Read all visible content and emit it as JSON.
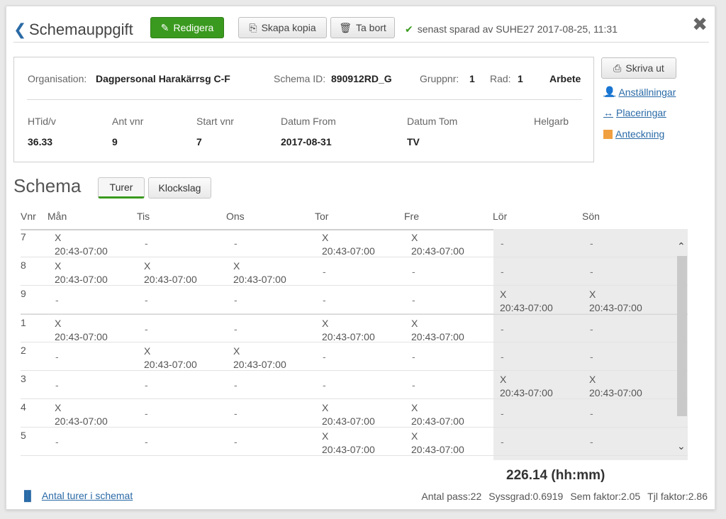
{
  "header": {
    "title": "Schemauppgift",
    "edit_label": "Redigera",
    "copy_label": "Skapa kopia",
    "delete_label": "Ta bort",
    "saved_text": "senast sparad av SUHE27 2017-08-25, 11:31"
  },
  "info": {
    "org_label": "Organisation:",
    "org_value": "Dagpersonal Harakärrsg C-F",
    "schema_id_label": "Schema ID:",
    "schema_id_value": "890912RD_G",
    "gruppnr_label": "Gruppnr:",
    "gruppnr_value": "1",
    "rad_label": "Rad:",
    "rad_value": "1",
    "arbete": "Arbete",
    "htid_label": "HTid/v",
    "htid_value": "36.33",
    "antvnr_label": "Ant vnr",
    "antvnr_value": "9",
    "startvnr_label": "Start vnr",
    "startvnr_value": "7",
    "datumfrom_label": "Datum From",
    "datumfrom_value": "2017-08-31",
    "datumtom_label": "Datum Tom",
    "datumtom_value": "TV",
    "helgarb_label": "Helgarb"
  },
  "side": {
    "print_label": "Skriva ut",
    "settings_label": "Anställningar",
    "placements_label": "Placeringar",
    "note_label": "Anteckning"
  },
  "schema": {
    "title": "Schema",
    "tab_turer": "Turer",
    "tab_klockslag": "Klockslag",
    "columns": [
      "Vnr",
      "Mån",
      "Tis",
      "Ons",
      "Tor",
      "Fre",
      "Lör",
      "Sön"
    ],
    "shift_mark": "X",
    "shift_time": "20:43-07:00",
    "empty": "-",
    "rows": [
      {
        "vnr": "7",
        "days": [
          1,
          0,
          0,
          1,
          1,
          0,
          0
        ]
      },
      {
        "vnr": "8",
        "days": [
          1,
          1,
          1,
          0,
          0,
          0,
          0
        ]
      },
      {
        "vnr": "9",
        "days": [
          0,
          0,
          0,
          0,
          0,
          1,
          1
        ]
      },
      {
        "vnr": "1",
        "days": [
          1,
          0,
          0,
          1,
          1,
          0,
          0
        ]
      },
      {
        "vnr": "2",
        "days": [
          0,
          1,
          1,
          0,
          0,
          0,
          0
        ]
      },
      {
        "vnr": "3",
        "days": [
          0,
          0,
          0,
          0,
          0,
          1,
          1
        ]
      },
      {
        "vnr": "4",
        "days": [
          1,
          0,
          0,
          1,
          1,
          0,
          0
        ]
      },
      {
        "vnr": "5",
        "days": [
          0,
          0,
          0,
          1,
          1,
          0,
          0
        ]
      }
    ]
  },
  "footer": {
    "total": "226.14 (hh:mm)",
    "link_label": "Antal turer i schemat",
    "antal_pass": "Antal pass:22",
    "syssgrad": "Syssgrad:0.6919",
    "sem_faktor": "Sem faktor:2.05",
    "tjl_faktor": "Tjl faktor:2.86"
  },
  "colors": {
    "accent_green": "#3a9a1f",
    "link_blue": "#2a6aa6",
    "weekend_bg": "#ebebeb"
  }
}
